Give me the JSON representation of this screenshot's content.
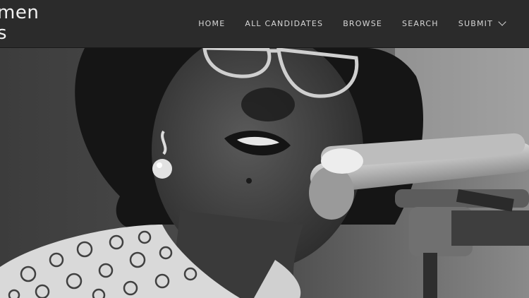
{
  "site": {
    "logo_line1": "men",
    "logo_line2": "s"
  },
  "nav": {
    "items": [
      {
        "label": "HOME"
      },
      {
        "label": "ALL CANDIDATES"
      },
      {
        "label": "BROWSE"
      },
      {
        "label": "SEARCH"
      },
      {
        "label": "SUBMIT"
      }
    ]
  },
  "hero": {
    "image": "black-and-white photo of a woman with glasses speaking into microphones"
  }
}
